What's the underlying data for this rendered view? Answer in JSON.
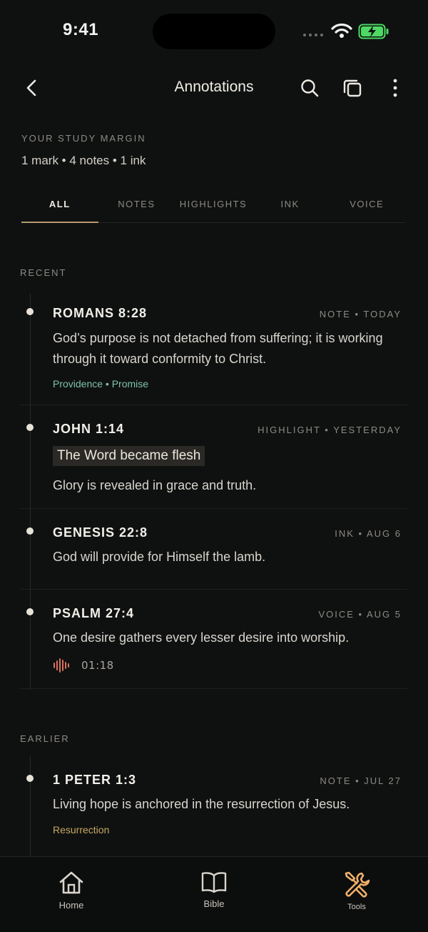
{
  "status": {
    "time": "9:41"
  },
  "header": {
    "title": "Annotations"
  },
  "summary": {
    "label": "YOUR STUDY MARGIN",
    "stats": "1 mark • 4 notes • 1 ink"
  },
  "tabs": [
    "ALL",
    "NOTES",
    "HIGHLIGHTS",
    "INK",
    "VOICE"
  ],
  "sections": {
    "recent": "RECENT",
    "earlier": "EARLIER"
  },
  "entries": [
    {
      "ref": "ROMANS 8:28",
      "meta": "NOTE • TODAY",
      "text": "God’s purpose is not detached from suffering; it is working through it toward conformity to Christ.",
      "tags": "Providence • Promise"
    },
    {
      "ref": "JOHN 1:14",
      "meta": "HIGHLIGHT • YESTERDAY",
      "highlight": "The Word became flesh",
      "text": "Glory is revealed in grace and truth."
    },
    {
      "ref": "GENESIS 22:8",
      "meta": "INK • AUG 6",
      "text": "God will provide for Himself the lamb."
    },
    {
      "ref": "PSALM 27:4",
      "meta": "VOICE • AUG 5",
      "text": "One desire gathers every lesser desire into worship.",
      "duration": "01:18"
    },
    {
      "ref": "1 PETER 1:3",
      "meta": "NOTE • JUL 27",
      "text": "Living hope is anchored in the resurrection of Jesus.",
      "tags": "Resurrection"
    }
  ],
  "nav": {
    "home": "Home",
    "bible": "Bible",
    "tools": "Tools"
  },
  "colors": {
    "accent": "#b49a72",
    "tag_teal": "#7ec1aa",
    "tag_gold": "#c8a860",
    "voice_red": "#d9705a",
    "tools_orange": "#f0b06a",
    "battery_green": "#4cd964"
  }
}
